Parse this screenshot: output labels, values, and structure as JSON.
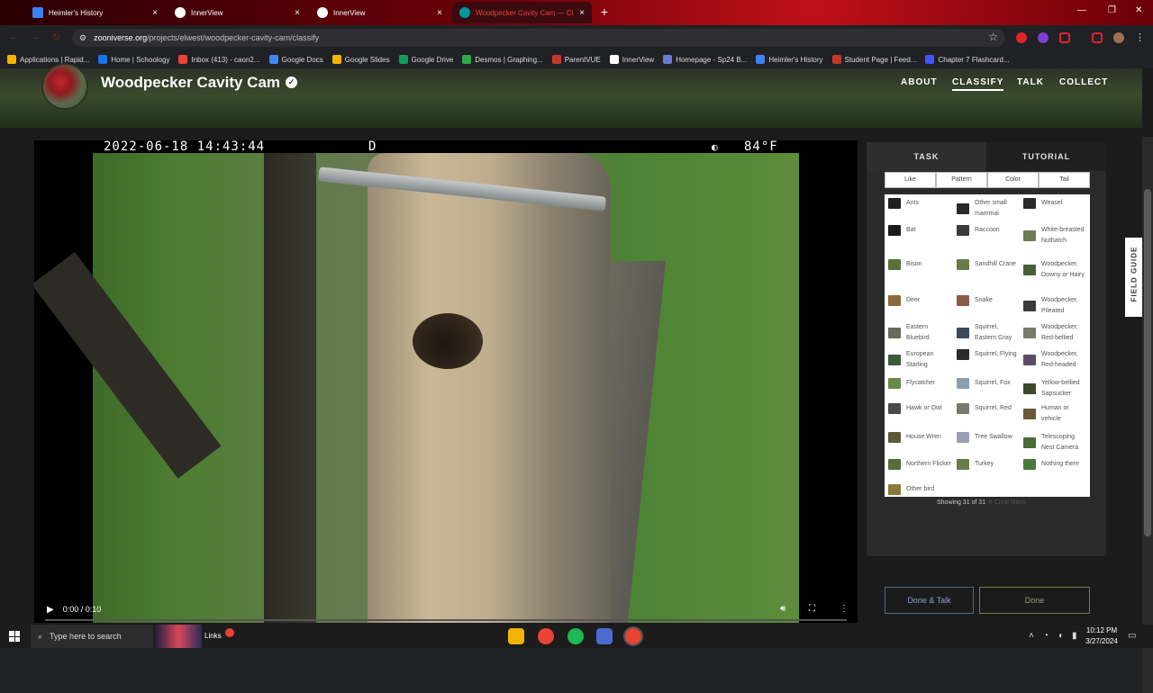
{
  "browser": {
    "tabs": [
      {
        "title": "Heimler's History",
        "favicon_color": "#3b82f6",
        "active": false
      },
      {
        "title": "InnerView",
        "favicon_color": "#ffffff",
        "active": false
      },
      {
        "title": "InnerView",
        "favicon_color": "#ffffff",
        "active": false
      },
      {
        "title": "Woodpecker Cavity Cam — Cla",
        "favicon_color": "#00979d",
        "active": true
      }
    ],
    "tab_close": "×",
    "new_tab": "+",
    "window_controls": {
      "minimize": "—",
      "restore": "❐",
      "close": "✕"
    },
    "url_host": "zooniverse.org",
    "url_path": "/projects/elwest/woodpecker-cavity-cam/classify",
    "bookmarks": [
      {
        "label": "Applications | Rapid...",
        "icon_color": "#f5b400"
      },
      {
        "label": "Home | Schoology",
        "icon_color": "#1a73e8"
      },
      {
        "label": "Inbox (413) - caon2...",
        "icon_color": "#ea4335"
      },
      {
        "label": "Google Docs",
        "icon_color": "#4285f4"
      },
      {
        "label": "Google Slides",
        "icon_color": "#f4b400"
      },
      {
        "label": "Google Drive",
        "icon_color": "#0f9d58"
      },
      {
        "label": "Desmos | Graphing...",
        "icon_color": "#2fa84f"
      },
      {
        "label": "ParentVUE",
        "icon_color": "#c0392b"
      },
      {
        "label": "InnerView",
        "icon_color": "#ffffff"
      },
      {
        "label": "Homepage - Sp24 B...",
        "icon_color": "#6a7bd6"
      },
      {
        "label": "Heimler's History",
        "icon_color": "#3b82f6"
      },
      {
        "label": "Student Page | Feed...",
        "icon_color": "#c0392b"
      },
      {
        "label": "Chapter 7 Flashcard...",
        "icon_color": "#4255ff"
      }
    ]
  },
  "project": {
    "title": "Woodpecker Cavity Cam",
    "nav": [
      "ABOUT",
      "CLASSIFY",
      "TALK",
      "COLLECT"
    ],
    "active_nav": "CLASSIFY"
  },
  "video": {
    "timestamp": "2022-06-18  14:43:44",
    "mode": "D",
    "temperature": "84°F",
    "time_display": "0:00 / 0:10",
    "progress_fraction": 0.0
  },
  "panel": {
    "tabs": [
      "TASK",
      "TUTORIAL"
    ],
    "filters": [
      "Like",
      "Pattern",
      "Color",
      "Tail"
    ],
    "choices": [
      {
        "label": "Ants",
        "thumb": "#1e1e1e"
      },
      {
        "label": "Other small mammal",
        "thumb": "#2a2a2a"
      },
      {
        "label": "Weasel",
        "thumb": "#2a2a2a"
      },
      {
        "label": "Bat",
        "thumb": "#1a1a1a"
      },
      {
        "label": "Raccoon",
        "thumb": "#3a3a3a"
      },
      {
        "label": "White-breasted Nuthatch",
        "thumb": "#6f7b52"
      },
      {
        "label": "Bison",
        "thumb": "#5a6e3a"
      },
      {
        "label": "Sandhill Crane",
        "thumb": "#6a7a4a"
      },
      {
        "label": "Woodpecker, Downy or Hairy",
        "thumb": "#4a5e3a"
      },
      {
        "label": "Deer",
        "thumb": "#8a6a3a"
      },
      {
        "label": "Snake",
        "thumb": "#8a5a4a"
      },
      {
        "label": "Woodpecker, Pileated",
        "thumb": "#3a3a3a"
      },
      {
        "label": "Eastern Bluebird",
        "thumb": "#6a6a5a"
      },
      {
        "label": "Squirrel, Eastern Gray",
        "thumb": "#3a4a5a"
      },
      {
        "label": "Woodpecker, Red-bellied",
        "thumb": "#7a7a6a"
      },
      {
        "label": "European Starling",
        "thumb": "#3a5a3a"
      },
      {
        "label": "Squirrel, Flying",
        "thumb": "#2a2a2a"
      },
      {
        "label": "Woodpecker, Red-headed",
        "thumb": "#5a4a6a"
      },
      {
        "label": "Flycatcher",
        "thumb": "#6a8a4a"
      },
      {
        "label": "Squirrel, Fox",
        "thumb": "#8aa0b0"
      },
      {
        "label": "Yellow-bellied Sapsucker",
        "thumb": "#3a4a2a"
      },
      {
        "label": "Hawk or Owl",
        "thumb": "#4a4a4a"
      },
      {
        "label": "Squirrel, Red",
        "thumb": "#7a7a6a"
      },
      {
        "label": "Human or vehicle",
        "thumb": "#6a5a3a"
      },
      {
        "label": "House Wren",
        "thumb": "#5a5a3a"
      },
      {
        "label": "Tree Swallow",
        "thumb": "#9aa0b0"
      },
      {
        "label": "Telescoping Nest Camera",
        "thumb": "#4a6a3a"
      },
      {
        "label": "Northern Flicker",
        "thumb": "#5a6a3a"
      },
      {
        "label": "Turkey",
        "thumb": "#6a7a4a"
      },
      {
        "label": "Nothing there",
        "thumb": "#4a7a3a"
      },
      {
        "label": "Other bird",
        "thumb": "#8a7a3a"
      }
    ],
    "showing": "Showing 31 of 31",
    "clear_filters": "⊘ Clear filters",
    "done_talk": "Done & Talk",
    "done": "Done",
    "field_guide": "FIELD GUIDE"
  },
  "taskbar": {
    "search_placeholder": "Type here to search",
    "links": "Links",
    "time": "10:12 PM",
    "date": "3/27/2024"
  }
}
